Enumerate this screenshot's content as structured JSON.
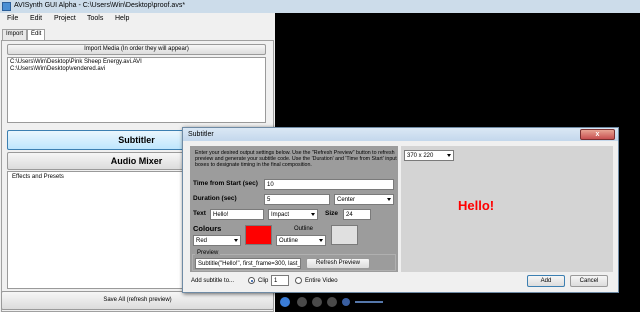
{
  "window": {
    "title": "AVISynth GUI Alpha - C:\\Users\\Win\\Desktop\\proof.avs*"
  },
  "menu": [
    "File",
    "Edit",
    "Project",
    "Tools",
    "Help"
  ],
  "tabs": [
    "Import",
    "Edit"
  ],
  "left": {
    "import_media_label": "Import Media (In order they will appear)",
    "media_files": [
      "C:\\Users\\Win\\Desktop\\Pink Sheep Energy.avi.AVI",
      "C:\\Users\\Win\\Desktop\\vendered.avi"
    ],
    "subtitler_label": "Subtitler",
    "audio_mixer_label": "Audio Mixer",
    "effects_label": "Effects and Presets",
    "save_all_label": "Save All (refresh preview)"
  },
  "dialog": {
    "title": "Subtitler",
    "close_label": "x",
    "instructions": "Enter your desired output settings below. Use the \"Refresh Preview\" button to refresh preview and generate your subtitle code. Use the 'Duration' and 'Time from Start' input boxes to designate timing in the final composition.",
    "time_from_start_label": "Time from Start (sec)",
    "time_from_start_value": "10",
    "duration_label": "Duration (sec)",
    "duration_value": "5",
    "alignment_value": "Center",
    "text_label": "Text",
    "text_value": "Hello!",
    "font_value": "Impact",
    "size_label": "Size",
    "size_value": "24",
    "colours_label": "Colours",
    "outline_label": "Outline",
    "colour_value": "Red",
    "outline_value": "Outline",
    "colour_hex": "#ff0000",
    "preview_group_label": "Preview",
    "code_value": "Subtitle(\"Hello!\", first_frame=300, last_",
    "refresh_label": "Refresh Preview",
    "resolution_value": "370 x 220",
    "preview_text": "Hello!",
    "add_to_label": "Add subtitle to...",
    "clip_label": "Clip",
    "clip_value": "1",
    "entire_video_label": "Entire Video",
    "add_label": "Add",
    "cancel_label": "Cancel"
  }
}
